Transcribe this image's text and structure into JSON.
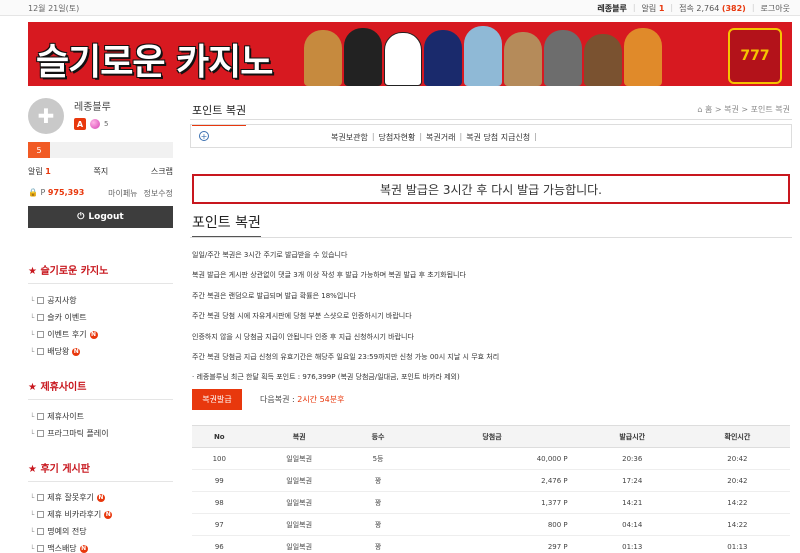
{
  "topbar": {
    "date": "12월 21일(토)",
    "username": "레종블루",
    "alarm_label": "알림",
    "alarm_count": "1",
    "visitors_label": "접속",
    "visitors_count": "2,764",
    "visitors_new": "(382)",
    "logout": "로그아웃"
  },
  "banner": {
    "logo": "슬기로운 카지노",
    "slot": "777"
  },
  "sidebar": {
    "user_name": "레종블루",
    "level_small": "5",
    "level_bar": "5",
    "alarm_label": "알림",
    "alarm_count": "1",
    "note": "쪽지",
    "scrap": "스크랩",
    "point_label": "P",
    "point_value": "975,393",
    "mypage": "마이페뉴",
    "edit_info": "정보수정",
    "logout_button": "Logout",
    "sections": [
      {
        "title": "슬기로운 카지노",
        "items": [
          {
            "label": "공지사항",
            "new": false
          },
          {
            "label": "슬카 이벤트",
            "new": false
          },
          {
            "label": "이벤트 후기",
            "new": true
          },
          {
            "label": "배당왕",
            "new": true
          }
        ]
      },
      {
        "title": "제휴사이트",
        "items": [
          {
            "label": "제휴사이트",
            "new": false
          },
          {
            "label": "프라그마틱 플레이",
            "new": false
          }
        ]
      },
      {
        "title": "후기 게시판",
        "items": [
          {
            "label": "제휴 잘못후기",
            "new": true
          },
          {
            "label": "제휴 비카라후기",
            "new": true
          },
          {
            "label": "명예의 전당",
            "new": false
          },
          {
            "label": "맥스배당",
            "new": true
          }
        ]
      }
    ],
    "new_badge": "N"
  },
  "main": {
    "page_title": "포인트 복권",
    "breadcrumb": "홈 > 복권 > 포인트 복권",
    "subnav": [
      "복권보관함",
      "당첨자현황",
      "복권거래",
      "복권 당첨 지급신청"
    ],
    "alert": "복권 발급은 3시간 후 다시 발급 가능합니다.",
    "section_title": "포인트 복권",
    "info_lines": [
      "일일/주간 복권은 3시간 주기로 발급받을 수 있습니다",
      "복권 발급은 게시판 상관없이 댓글 3개 이상 작성 후 발급 가능하며 복권 발급 후 초기화됩니다",
      "주간 복권은 랜덤으로 발급되며 발급 확률은 18%입니다",
      "주간 복권 당첨 시에 자유게시판에 당첨 부분 스샷으로 인증하시기 바랍니다",
      "인증하지 않을 시 당첨금 지급이 안됩니다 인증 후 지급 신청하시기 바랍니다",
      "주간 복권 당첨금 지급 신청의 유효기간은 해당주 일요일 23:59까지만 신청 가능 00시 지날 시 무효 처리"
    ],
    "recent_prefix": "· 레종블루님 최근 한달 획득 포인트 : 976,399P (복권 당첨금/일대금, 포인트 바카라 제외)",
    "issue_button": "복권발급",
    "next_label": "다음복권 :",
    "next_time": "2시간 54분후",
    "table": {
      "headers": [
        "No",
        "복권",
        "등수",
        "당첨금",
        "발급시간",
        "확인시간"
      ],
      "rows": [
        [
          "100",
          "일일복권",
          "5등",
          "40,000 P",
          "20:36",
          "20:42"
        ],
        [
          "99",
          "일일복권",
          "꽝",
          "2,476 P",
          "17:24",
          "20:42"
        ],
        [
          "98",
          "일일복권",
          "꽝",
          "1,377 P",
          "14:21",
          "14:22"
        ],
        [
          "97",
          "일일복권",
          "꽝",
          "800 P",
          "04:14",
          "14:22"
        ],
        [
          "96",
          "일일복권",
          "꽝",
          "297 P",
          "01:13",
          "01:13"
        ]
      ]
    }
  },
  "colors": {
    "accent": "#e8380d",
    "brand_red": "#d71920",
    "dark_button": "#3d3d3d"
  }
}
